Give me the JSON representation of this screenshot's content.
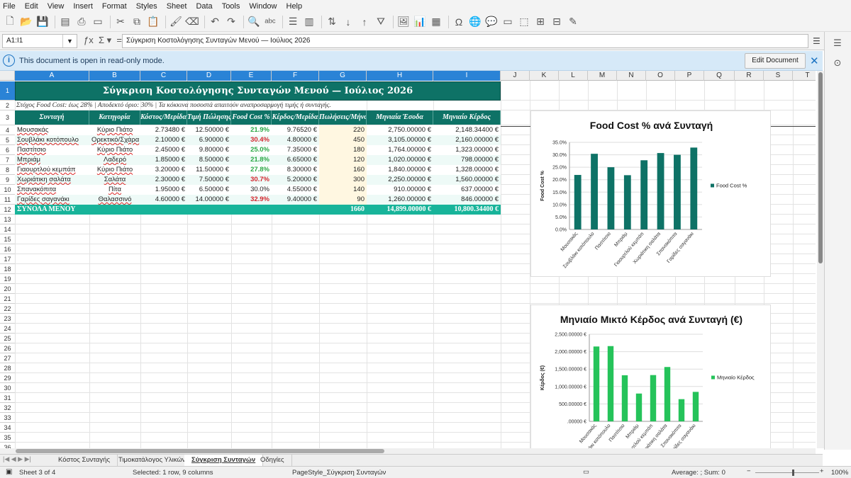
{
  "menu": [
    "File",
    "Edit",
    "View",
    "Insert",
    "Format",
    "Styles",
    "Sheet",
    "Data",
    "Tools",
    "Window",
    "Help"
  ],
  "namebox": "A1:I1",
  "formula": "Σύγκριση Κοστολόγησης Συνταγών Μενού — Ιούλιος 2026",
  "info": {
    "text": "This document is open in read-only mode.",
    "button": "Edit Document"
  },
  "columns": [
    "A",
    "B",
    "C",
    "D",
    "E",
    "F",
    "G",
    "H",
    "I",
    "J",
    "K",
    "L",
    "M",
    "N",
    "O",
    "P",
    "Q",
    "R",
    "S",
    "T"
  ],
  "rows": [
    "1",
    "2",
    "3",
    "4",
    "5",
    "6",
    "7",
    "8",
    "9",
    "10",
    "11",
    "12",
    "13",
    "14",
    "15",
    "16",
    "17",
    "18",
    "19",
    "20",
    "21",
    "22",
    "23",
    "24",
    "25",
    "26",
    "27",
    "28",
    "29",
    "30",
    "31",
    "32",
    "33",
    "34",
    "35",
    "36"
  ],
  "sheet": {
    "title": "Σύγκριση Κοστολόγησης Συνταγών Μενού — Ιούλιος 2026",
    "subtitle": "Στόχος Food Cost: έως 28% | Αποδεκτό όριο: 30% | Τα κόκκινα ποσοστά απαιτούν αναπροσαρμογή τιμής ή συνταγής.",
    "headers": [
      "Συνταγή",
      "Κατηγορία",
      "Κόστος/Μερίδα",
      "Τιμή Πώλησης",
      "Food Cost %",
      "Κέρδος/Μερίδα",
      "Πωλήσεις/Μήνα",
      "Μηνιαία Έσοδα",
      "Μηνιαίο Κέρδος"
    ],
    "data": [
      [
        "Μουσακάς",
        "Κύριο Πιάτο",
        "2.73480 €",
        "12.50000 €",
        "21.9%",
        "9.76520 €",
        "220",
        "2,750.00000 €",
        "2,148.34400 €"
      ],
      [
        "Σουβλάκι κοτόπουλο",
        "Ορεκτικό/Σχάρα",
        "2.10000 €",
        "6.90000 €",
        "30.4%",
        "4.80000 €",
        "450",
        "3,105.00000 €",
        "2,160.00000 €"
      ],
      [
        "Παστίτσιο",
        "Κύριο Πιάτο",
        "2.45000 €",
        "9.80000 €",
        "25.0%",
        "7.35000 €",
        "180",
        "1,764.00000 €",
        "1,323.00000 €"
      ],
      [
        "Μπριάμ",
        "Λαδερό",
        "1.85000 €",
        "8.50000 €",
        "21.8%",
        "6.65000 €",
        "120",
        "1,020.00000 €",
        "798.00000 €"
      ],
      [
        "Γιαουρτλού κεμπάπ",
        "Κύριο Πιάτο",
        "3.20000 €",
        "11.50000 €",
        "27.8%",
        "8.30000 €",
        "160",
        "1,840.00000 €",
        "1,328.00000 €"
      ],
      [
        "Χωριάτικη σαλάτα",
        "Σαλάτα",
        "2.30000 €",
        "7.50000 €",
        "30.7%",
        "5.20000 €",
        "300",
        "2,250.00000 €",
        "1,560.00000 €"
      ],
      [
        "Σπανακόπιτα",
        "Πίτα",
        "1.95000 €",
        "6.50000 €",
        "30.0%",
        "4.55000 €",
        "140",
        "910.00000 €",
        "637.00000 €"
      ],
      [
        "Γαρίδες σαγανάκι",
        "Θαλασσινό",
        "4.60000 €",
        "14.00000 €",
        "32.9%",
        "9.40000 €",
        "90",
        "1,260.00000 €",
        "846.00000 €"
      ]
    ],
    "fc_status": [
      "grn",
      "red",
      "grn",
      "grn",
      "grn",
      "red",
      "",
      "red"
    ],
    "totals": {
      "label": "ΣΥΝΟΛΑ ΜΕΝΟΥ",
      "sales": "1660",
      "revenue": "14,899.00000 €",
      "profit": "10,800.34400 €"
    }
  },
  "chart_data": [
    {
      "type": "bar",
      "title": "Food Cost % ανά Συνταγή",
      "ylabel": "Food Cost %",
      "legend": "Food Cost %",
      "legend_position": "right",
      "color": "#0e7266",
      "categories": [
        "Μουσακάς",
        "Σουβλάκι κοτόπουλο",
        "Παστίτσιο",
        "Μπριάμ",
        "Γιαουρτλού κεμπάπ",
        "Χωριάτικη σαλάτα",
        "Σπανακόπιτα",
        "Γαρίδες σαγανάκι"
      ],
      "values": [
        21.9,
        30.4,
        25.0,
        21.8,
        27.8,
        30.7,
        30.0,
        32.9
      ],
      "ylim": [
        0,
        35
      ],
      "yticks": [
        "35.0%",
        "30.0%",
        "25.0%",
        "20.0%",
        "15.0%",
        "10.0%",
        "5.0%",
        "0.0%"
      ]
    },
    {
      "type": "bar",
      "title": "Μηνιαίο Μικτό Κέρδος ανά Συνταγή (€)",
      "ylabel": "Κέρδος (€)",
      "legend": "Μηνιαίο Κέρδος",
      "legend_position": "right",
      "color": "#25c35a",
      "categories": [
        "Μουσακάς",
        "Σουβλάκι κοτόπουλο",
        "Παστίτσιο",
        "Μπριάμ",
        "Γιαουρτλού κεμπάπ",
        "Χωριάτικη σαλάτα",
        "Σπανακόπιτα",
        "Γαρίδες σαγανάκι"
      ],
      "values": [
        2148.344,
        2160,
        1323,
        798,
        1328,
        1560,
        637,
        846
      ],
      "ylim": [
        0,
        2500
      ],
      "yticks": [
        "2,500.00000 €",
        "2,000.00000 €",
        "1,500.00000 €",
        "1,000.00000 €",
        "500.00000 €",
        ".00000 €"
      ]
    }
  ],
  "tabs": [
    "Κόστος Συνταγής",
    "Τιμοκατάλογος Υλικών",
    "Σύγκριση Συνταγών",
    "Οδηγίες"
  ],
  "active_tab": "Σύγκριση Συνταγών",
  "status": {
    "sheet": "Sheet 3 of 4",
    "selection": "Selected: 1 row, 9 columns",
    "pagestyle": "PageStyle_Σύγκριση Συνταγών",
    "sum": "Average: ; Sum: 0",
    "zoom": "100%"
  }
}
